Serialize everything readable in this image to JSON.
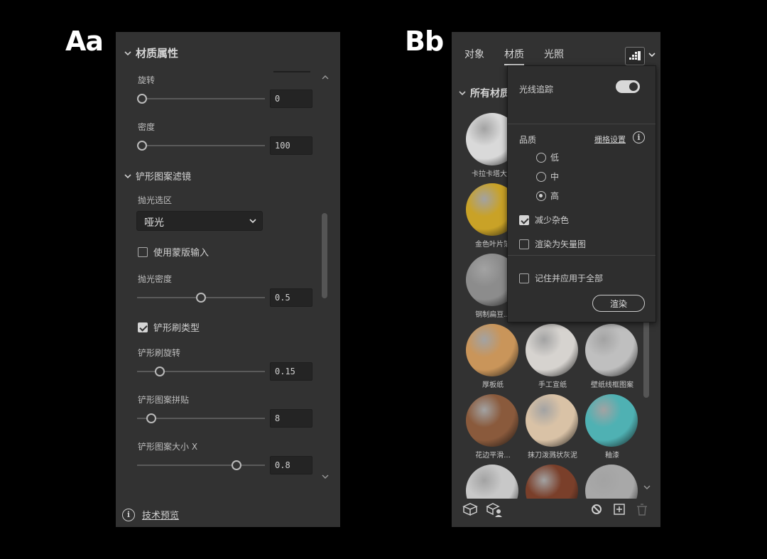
{
  "labels": {
    "a": "Aa",
    "b": "Bb"
  },
  "panel_a": {
    "section_title": "材质属性",
    "rotation": {
      "label": "旋转",
      "value": "0",
      "fraction": 0.0
    },
    "density": {
      "label": "密度",
      "value": "100",
      "fraction": 0.0
    },
    "shovel_filter_title": "铲形图案滤镜",
    "polish_area": {
      "label": "抛光选区",
      "selected": "哑光"
    },
    "use_mask_input": {
      "label": "使用蒙版输入",
      "checked": false
    },
    "polish_density": {
      "label": "抛光密度",
      "value": "0.5",
      "fraction": 0.5
    },
    "brush_type": {
      "label": "铲形刷类型",
      "checked": true
    },
    "brush_rotation": {
      "label": "铲形刷旋转",
      "value": "0.15",
      "fraction": 0.15
    },
    "pattern_tiling": {
      "label": "铲形图案拼贴",
      "value": "8",
      "fraction": 0.08
    },
    "pattern_size_x": {
      "label": "铲形图案大小 X",
      "value": "0.8",
      "fraction": 0.8
    },
    "footer": "技术预览"
  },
  "panel_b": {
    "tabs": [
      "对象",
      "材质",
      "光照"
    ],
    "active_tab": "材质",
    "all_materials_title": "所有材质",
    "materials": [
      {
        "label": "卡拉卡塔大理",
        "color": "#d9d9d9"
      },
      {
        "label": "",
        "color": "#888"
      },
      {
        "label": "",
        "color": "#888"
      },
      {
        "label": "金色叶片箔",
        "color": "#c9a227"
      },
      {
        "label": "",
        "color": "#888"
      },
      {
        "label": "",
        "color": "#888"
      },
      {
        "label": "钢制扁豆...",
        "color": "#8c8c8c"
      },
      {
        "label": "",
        "color": "#888"
      },
      {
        "label": "",
        "color": "#888"
      },
      {
        "label": "厚板纸",
        "color": "#c9955a"
      },
      {
        "label": "手工宣纸",
        "color": "#d6d3cf"
      },
      {
        "label": "壁纸线框图案",
        "color": "#bfbfbf"
      },
      {
        "label": "花边平滑...",
        "color": "#8a5a3c"
      },
      {
        "label": "抹刀泼溅状灰泥",
        "color": "#d9c2a6"
      },
      {
        "label": "釉漆",
        "color": "#4fb1b3"
      },
      {
        "label": "",
        "color": "#c8c8c8"
      },
      {
        "label": "",
        "color": "#7a3f2a"
      },
      {
        "label": "",
        "color": "#a8a8a8"
      }
    ],
    "popup": {
      "ray_tracing": "光线追踪",
      "ray_tracing_on": true,
      "quality": "品质",
      "grid_settings": "栅格设置",
      "quality_options": [
        "低",
        "中",
        "高"
      ],
      "quality_selected": "高",
      "reduce_noise": {
        "label": "减少杂色",
        "checked": true
      },
      "render_vector": {
        "label": "渲染为矢量图",
        "checked": false
      },
      "remember_apply": {
        "label": "记住并应用于全部",
        "checked": false
      },
      "render_button": "渲染"
    }
  }
}
